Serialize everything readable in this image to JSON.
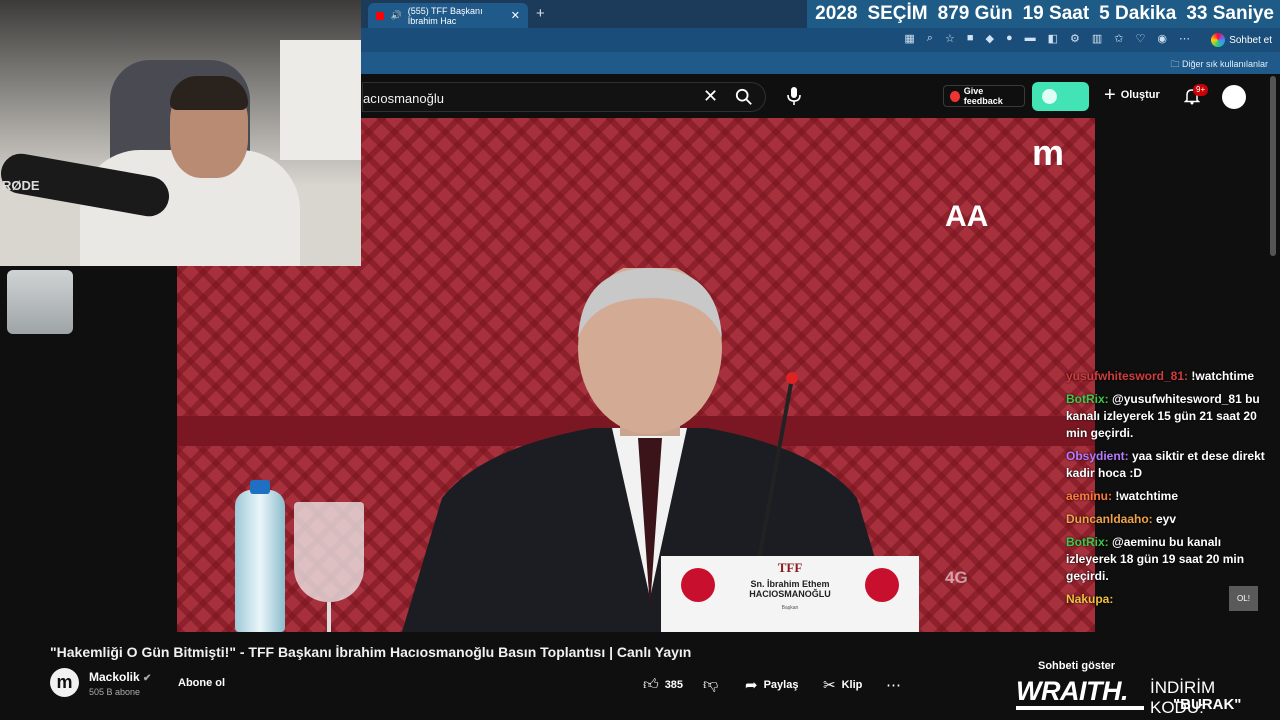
{
  "browser": {
    "tab_title": "(555) TFF Başkanı İbrahim Hac",
    "countdown": {
      "year": "2028",
      "label_secim": "SEÇİM",
      "days": "879",
      "days_label": "Gün",
      "hours": "19",
      "hours_label": "Saat",
      "minutes": "5",
      "minutes_label": "Dakika",
      "seconds": "33",
      "seconds_label": "Saniye"
    },
    "chat_button": "Sohbet et",
    "bookmarks_other": "Diğer sık kullanılanlar"
  },
  "youtube": {
    "search_value": "acıosmanoğlu",
    "feedback_label": "Give feedback",
    "create_label": "Oluştur",
    "notif_badge": "9+"
  },
  "video": {
    "channel_logo": "m",
    "agency_logo": "AA",
    "watermark_4g": "4G",
    "plaque": {
      "org": "TFF",
      "line1": "Sn. İbrahim Ethem",
      "line2": "HACIOSMANOĞLU",
      "role": "Başkan"
    },
    "webcam_mic_brand": "RØDE"
  },
  "meta": {
    "title": "\"Hakemliği O Gün Bitmişti!\" - TFF Başkanı İbrahim Hacıosmanoğlu Basın Toplantısı | Canlı Yayın",
    "channel_initial": "m",
    "channel_name": "Mackolik",
    "subscribers": "505 B abone",
    "subscribe_label": "Abone ol",
    "likes": "385",
    "share_label": "Paylaş",
    "clip_label": "Klip",
    "more_label": "⋯"
  },
  "chat": {
    "messages": [
      {
        "user": "yusufwhitesword_81:",
        "user_color": "#d13c3c",
        "text": " !watchtime"
      },
      {
        "user": "BotRix:",
        "user_color": "#3ec94a",
        "text": " @yusufwhitesword_81 bu kanalı izleyerek 15 gün 21 saat 20 min geçirdi."
      },
      {
        "user": "Obsydient:",
        "user_color": "#b57bff",
        "text": " yaa siktir et dese direkt kadir hoca :D"
      },
      {
        "user": "aeminu:",
        "user_color": "#ff7a3d",
        "text": " !watchtime"
      },
      {
        "user": "Duncanldaaho:",
        "user_color": "#f0a14a",
        "text": " eyv"
      },
      {
        "user": "BotRix:",
        "user_color": "#3ec94a",
        "text": " @aeminu bu kanalı izleyerek 18 gün 19 saat 20 min geçirdi."
      },
      {
        "user": "Nakupa:",
        "user_color": "#f0c040",
        "text": ""
      }
    ],
    "ol_label": "OL!",
    "show_chat": "Sohbeti göster",
    "promo_brand": "WRAITH.",
    "promo_line": "İNDİRİM KODU:",
    "promo_code": "\"BURAK\""
  }
}
